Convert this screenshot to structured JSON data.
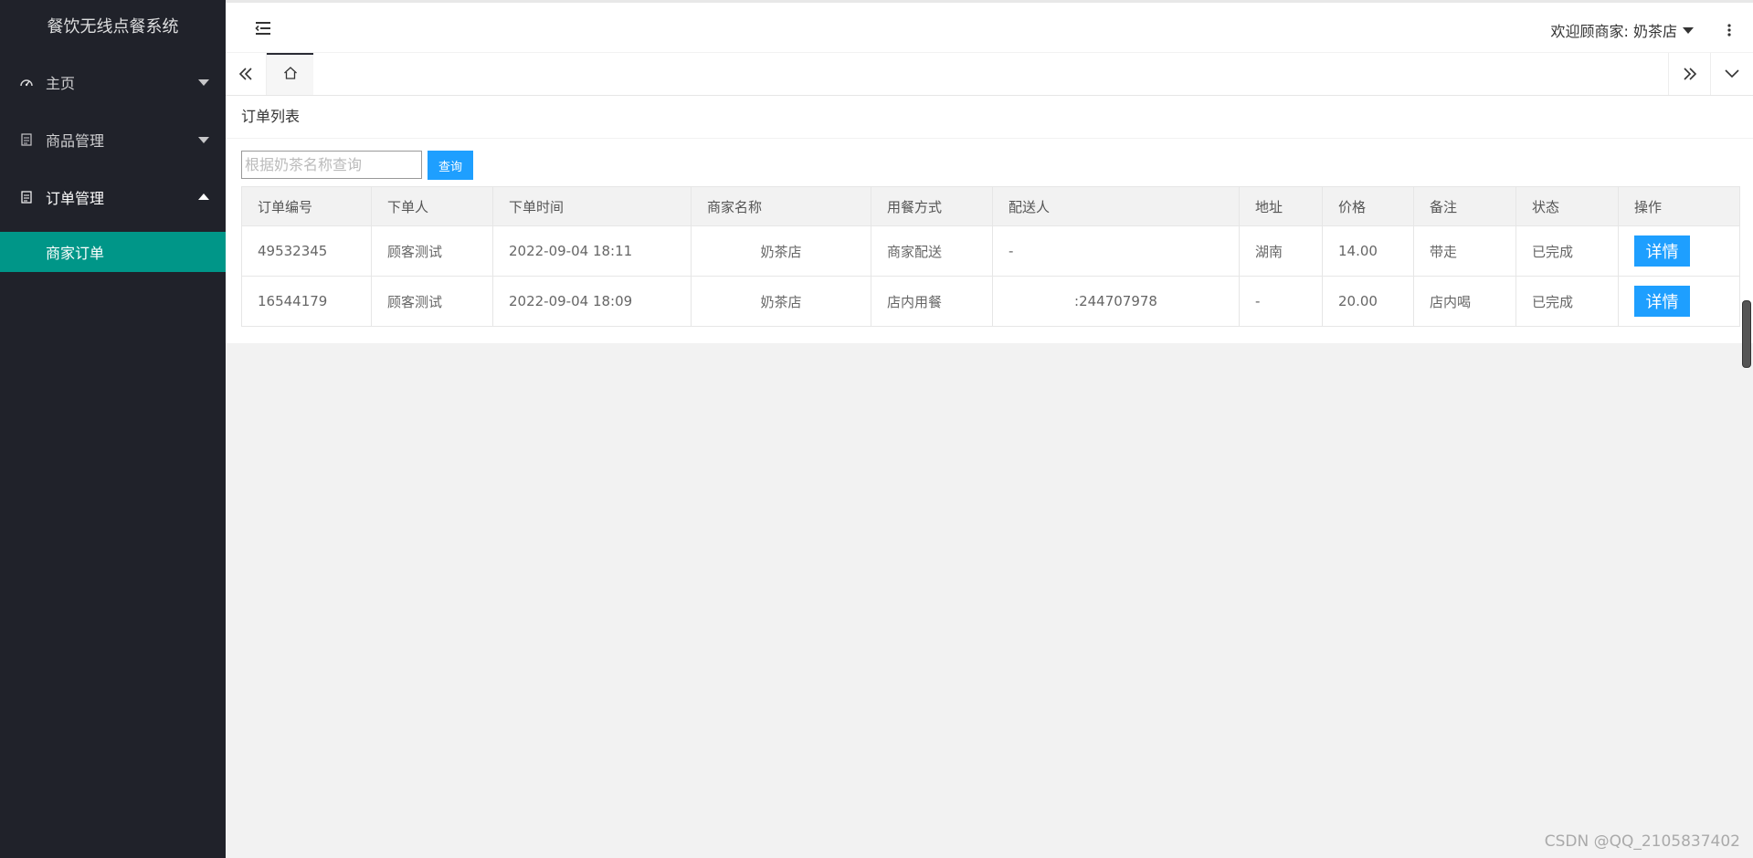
{
  "app": {
    "title": "餐饮无线点餐系统"
  },
  "sidebar": {
    "items": [
      {
        "label": "主页",
        "icon": "dashboard-icon",
        "expanded": false
      },
      {
        "label": "商品管理",
        "icon": "document-icon",
        "expanded": false
      },
      {
        "label": "订单管理",
        "icon": "document-icon",
        "expanded": true
      }
    ],
    "subitem": {
      "label": "商家订单",
      "active": true
    }
  },
  "header": {
    "welcome": "欢迎顾商家: 奶茶店"
  },
  "tabs": {
    "home_icon": "home-icon"
  },
  "main": {
    "card_title": "订单列表",
    "search": {
      "placeholder": "根据奶茶名称查询",
      "value": "",
      "button": "查询"
    },
    "table": {
      "columns": [
        "订单编号",
        "下单人",
        "下单时间",
        "商家名称",
        "用餐方式",
        "配送人",
        "地址",
        "价格",
        "备注",
        "状态",
        "操作"
      ],
      "rows": [
        {
          "order_id": "49532345",
          "customer": "顾客测试",
          "time": "2022-09-04 18:11",
          "merchant": "奶茶店",
          "dining": "商家配送",
          "courier": "-",
          "address": "湖南",
          "price": "14.00",
          "note": "带走",
          "status": "已完成",
          "action": "详情"
        },
        {
          "order_id": "16544179",
          "customer": "顾客测试",
          "time": "2022-09-04 18:09",
          "merchant": "奶茶店",
          "dining": "店内用餐",
          "courier": ":244707978",
          "address": "-",
          "price": "20.00",
          "note": "店内喝",
          "status": "已完成",
          "action": "详情"
        }
      ]
    }
  },
  "watermark": "CSDN @QQ_2105837402",
  "colors": {
    "sidebar": "#20222a",
    "accent": "#009688",
    "button": "#1e9fff"
  }
}
